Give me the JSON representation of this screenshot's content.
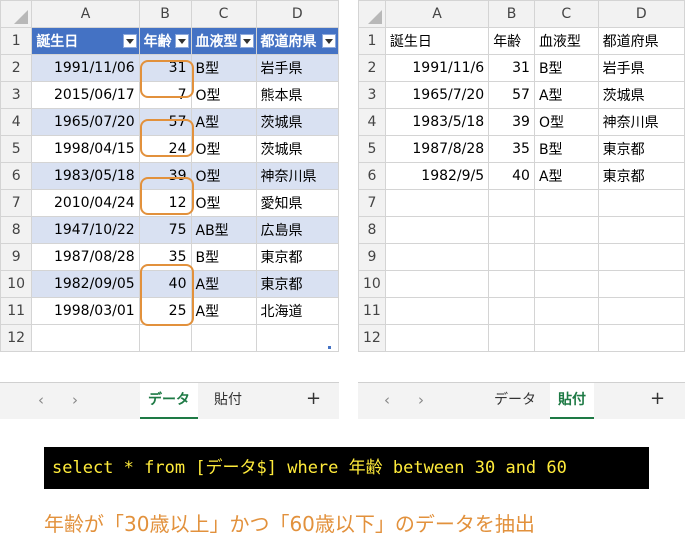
{
  "left": {
    "columns": [
      "A",
      "B",
      "C",
      "D"
    ],
    "header": [
      "誕生日",
      "年齢",
      "血液型",
      "都道府県"
    ],
    "rows": [
      {
        "n": "2",
        "birth": "1991/11/06",
        "age": "31",
        "blood": "B型",
        "pref": "岩手県"
      },
      {
        "n": "3",
        "birth": "2015/06/17",
        "age": "7",
        "blood": "O型",
        "pref": "熊本県"
      },
      {
        "n": "4",
        "birth": "1965/07/20",
        "age": "57",
        "blood": "A型",
        "pref": "茨城県"
      },
      {
        "n": "5",
        "birth": "1998/04/15",
        "age": "24",
        "blood": "O型",
        "pref": "茨城県"
      },
      {
        "n": "6",
        "birth": "1983/05/18",
        "age": "39",
        "blood": "O型",
        "pref": "神奈川県"
      },
      {
        "n": "7",
        "birth": "2010/04/24",
        "age": "12",
        "blood": "O型",
        "pref": "愛知県"
      },
      {
        "n": "8",
        "birth": "1947/10/22",
        "age": "75",
        "blood": "AB型",
        "pref": "広島県"
      },
      {
        "n": "9",
        "birth": "1987/08/28",
        "age": "35",
        "blood": "B型",
        "pref": "東京都"
      },
      {
        "n": "10",
        "birth": "1982/09/05",
        "age": "40",
        "blood": "A型",
        "pref": "東京都"
      },
      {
        "n": "11",
        "birth": "1998/03/01",
        "age": "25",
        "blood": "A型",
        "pref": "北海道"
      }
    ],
    "row_numbers": [
      "1",
      "12"
    ],
    "tabs": {
      "data": "データ",
      "paste": "貼付",
      "add": "+"
    },
    "nav": {
      "prev": "‹",
      "next": "›"
    }
  },
  "right": {
    "columns": [
      "A",
      "B",
      "C",
      "D"
    ],
    "header": [
      "誕生日",
      "年齢",
      "血液型",
      "都道府県"
    ],
    "rows": [
      {
        "n": "2",
        "birth": "1991/11/6",
        "age": "31",
        "blood": "B型",
        "pref": "岩手県"
      },
      {
        "n": "3",
        "birth": "1965/7/20",
        "age": "57",
        "blood": "A型",
        "pref": "茨城県"
      },
      {
        "n": "4",
        "birth": "1983/5/18",
        "age": "39",
        "blood": "O型",
        "pref": "神奈川県"
      },
      {
        "n": "5",
        "birth": "1987/8/28",
        "age": "35",
        "blood": "B型",
        "pref": "東京都"
      },
      {
        "n": "6",
        "birth": "1982/9/5",
        "age": "40",
        "blood": "A型",
        "pref": "東京都"
      }
    ],
    "row_numbers": [
      "1",
      "7",
      "8",
      "9",
      "10",
      "11",
      "12"
    ],
    "tabs": {
      "data": "データ",
      "paste": "貼付",
      "add": "+"
    },
    "nav": {
      "prev": "‹",
      "next": "›"
    }
  },
  "sql": "select * from [データ$] where 年齢 between 30 and 60",
  "caption": "年齢が「30歳以上」かつ「60歳以下」のデータを抽出",
  "colors": {
    "header_bg": "#4472c4",
    "band": "#d9e1f2",
    "highlight": "#e2913c",
    "sql_text": "#ffeb3b",
    "tab_active": "#1e7a45"
  }
}
